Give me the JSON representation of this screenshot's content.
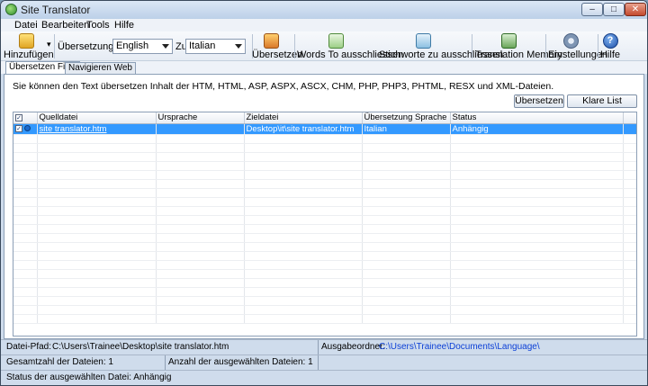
{
  "window": {
    "title": "Site Translator"
  },
  "menu": [
    "Datei",
    "Bearbeiten",
    "Tools",
    "Hilfe"
  ],
  "toolbar": {
    "add_label": "Hinzufügen",
    "translate_from_label": "Übersetzung aus",
    "source_lang": "English",
    "to_label": "Zu",
    "target_lang": "Italian",
    "translate_label": "Übersetzen",
    "exclude_words_label": "Words To ausschliessen",
    "exclude_keywords_label": "Stichworte zu ausschliessen",
    "memory_label": "Translation Memory",
    "settings_label": "Einstellungen",
    "help_label": "Hilfe"
  },
  "tabs": [
    "Übersetzen Files",
    "Navigieren Web"
  ],
  "panel": {
    "info": "Sie können den Text übersetzen Inhalt der HTM, HTML, ASP, ASPX, ASCX, CHM, PHP, PHP3, PHTML, RESX und XML-Dateien.",
    "translate_button": "Übersetzen",
    "clear_button": "Klare List"
  },
  "table": {
    "columns": [
      "Quelldatei",
      "Ursprache",
      "Zieldatei",
      "Übersetzung Sprache",
      "Status"
    ],
    "rows": [
      {
        "checked": true,
        "source": "site translator.htm",
        "origin_lang": "",
        "target": "Desktop\\it\\site translator.htm",
        "trans_lang": "Italian",
        "status": "Anhängig"
      }
    ]
  },
  "status": {
    "path_label": "Datei-Pfad:",
    "path_value": "C:\\Users\\Trainee\\Desktop\\site translator.htm",
    "output_label": "Ausgabeordner:",
    "output_value": "C:\\Users\\Trainee\\Documents\\Language\\",
    "total": "Gesamtzahl der Dateien: 1",
    "selected": "Anzahl der ausgewählten Dateien: 1",
    "selected_status": "Status der ausgewählten Datei:  Anhängig"
  },
  "colors": {
    "selection": "#3399ff",
    "link": "#0b3fd6"
  }
}
